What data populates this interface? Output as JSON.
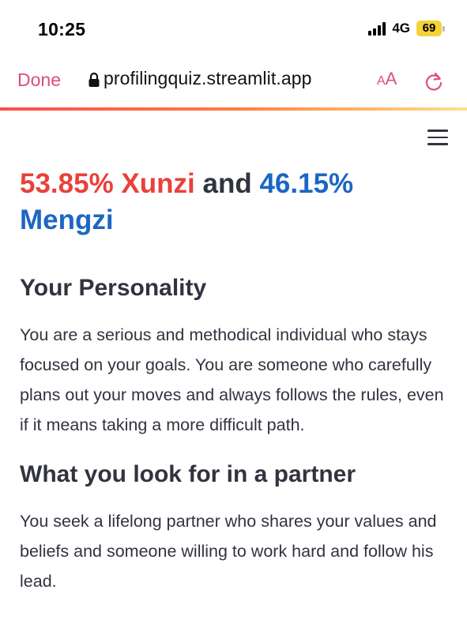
{
  "status_bar": {
    "time": "10:25",
    "network": "4G",
    "battery": "69"
  },
  "browser": {
    "done_label": "Done",
    "url": "profilingquiz.streamlit.app",
    "text_size_small": "A",
    "text_size_big": "A",
    "accent_color": "#d94f7a"
  },
  "result": {
    "xunzi_percent": "53.85% Xunzi",
    "connector": "and",
    "mengzi_percent": "46.15%",
    "mengzi_name": "Mengzi",
    "xunzi_color": "#e8413a",
    "mengzi_color": "#1c66c4"
  },
  "personality": {
    "heading": "Your Personality",
    "text": "You are a serious and methodical individual who stays focused on your goals. You are someone who carefully plans out your moves and always follows the rules, even if it means taking a more difficult path."
  },
  "partner": {
    "heading": "What you look for in a partner",
    "text": "You seek a lifelong partner who shares your values and beliefs and someone willing to work hard and follow his lead."
  },
  "icons": {
    "menu": "hamburger-menu-icon",
    "lock": "lock-icon",
    "reload": "reload-icon",
    "signal": "signal-icon",
    "battery": "battery-icon"
  }
}
